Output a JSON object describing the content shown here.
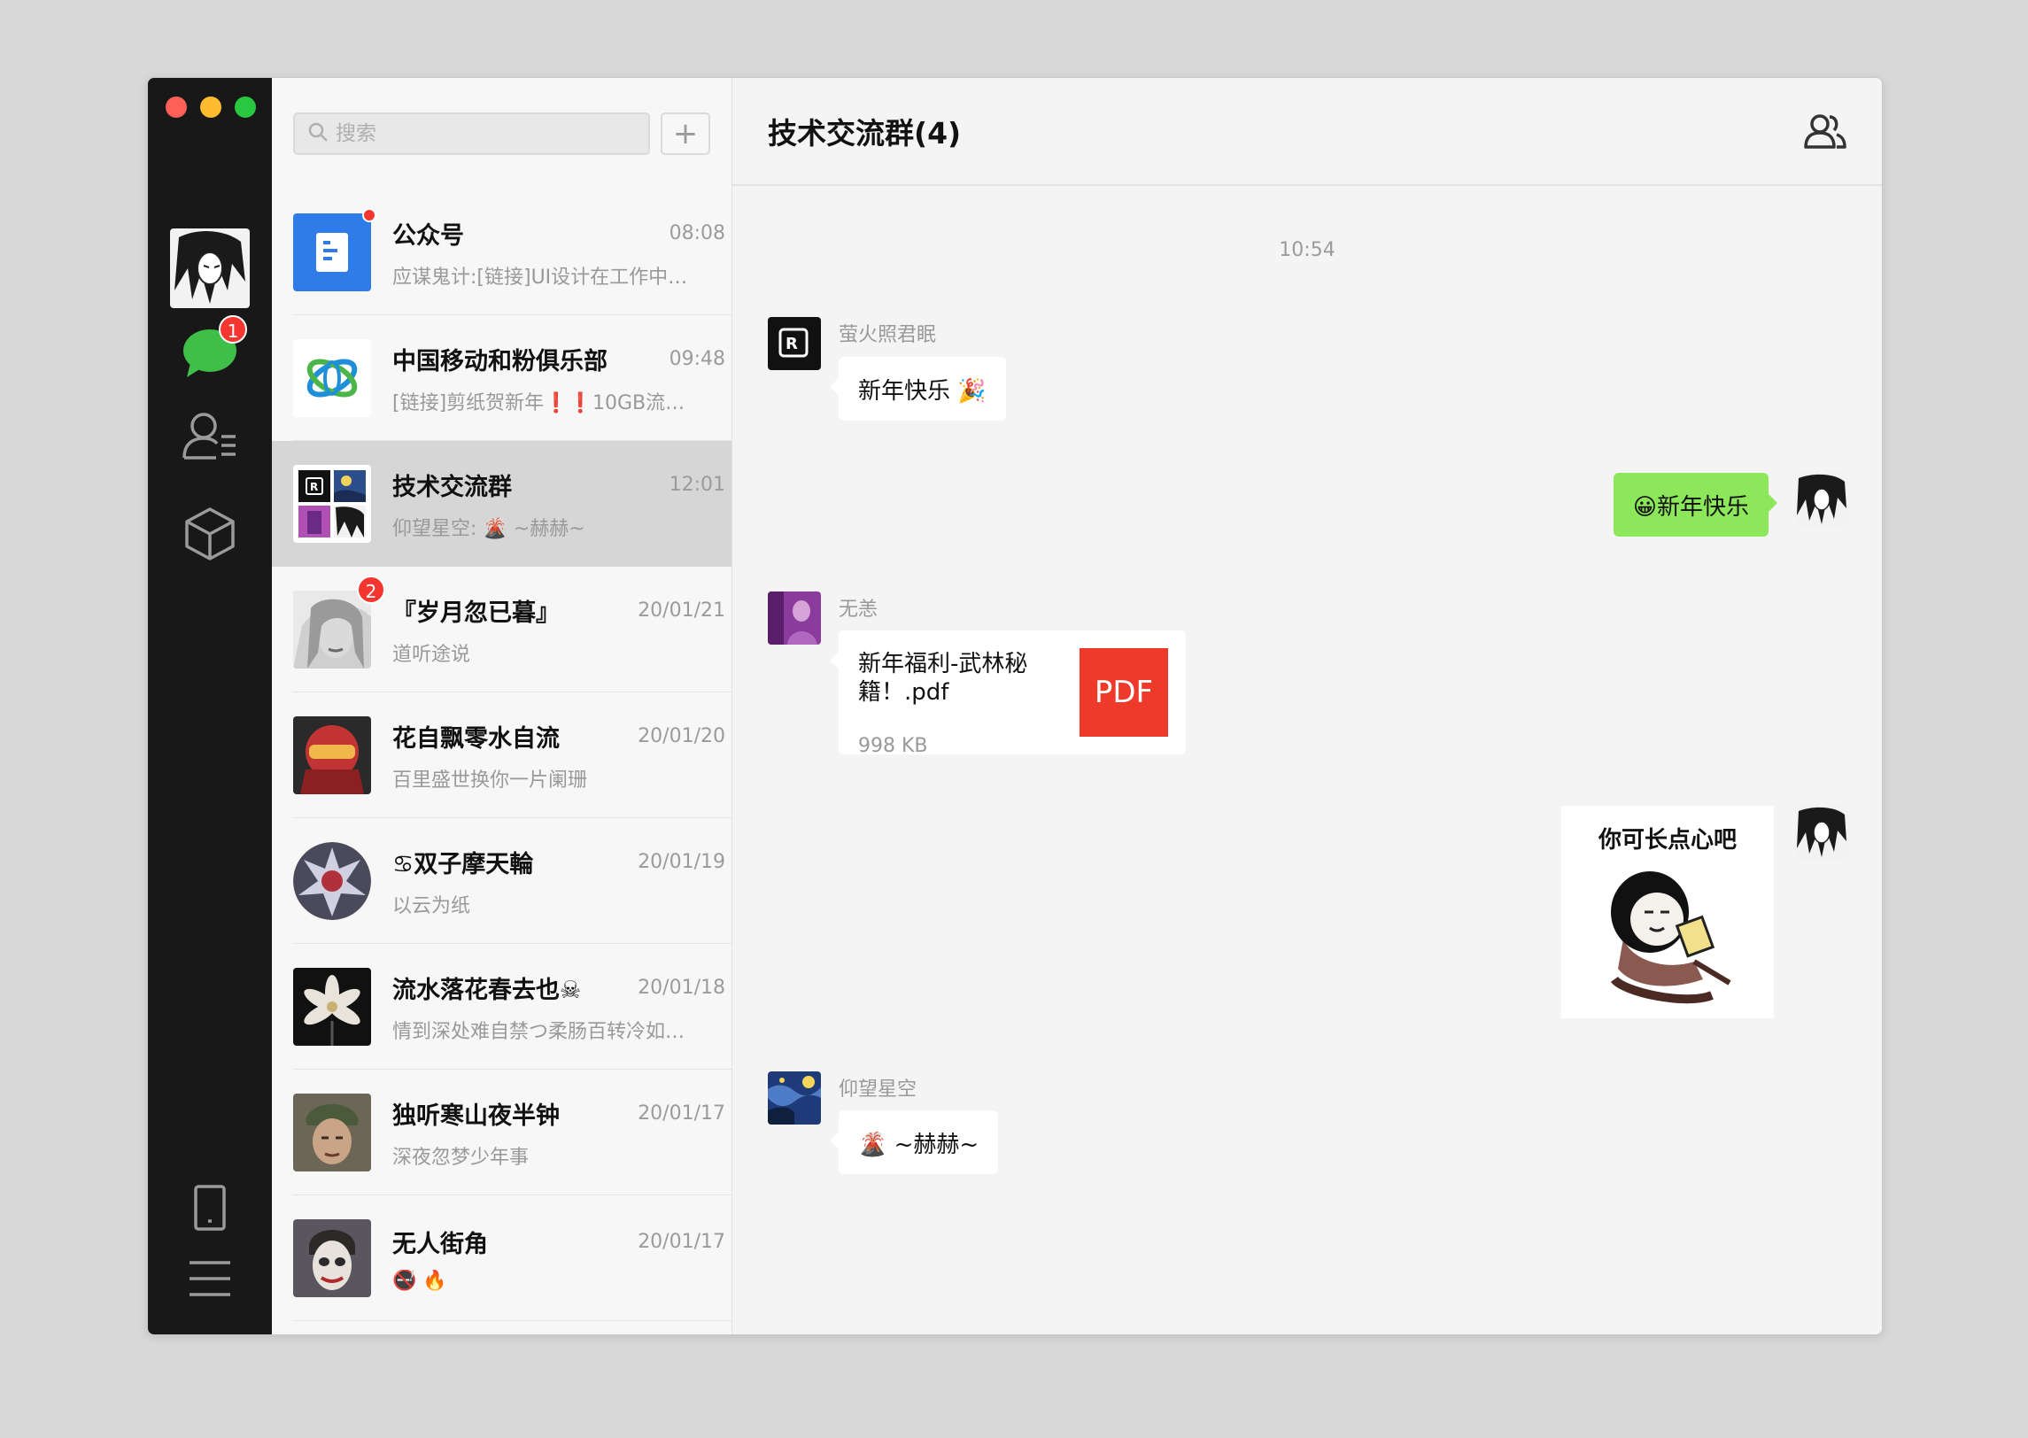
{
  "colors": {
    "accent_green": "#3fbf47",
    "badge_red": "#f43530",
    "own_bubble": "#8ce85a",
    "pdf_red": "#ee3a2b"
  },
  "rail": {
    "chat_badge": "1",
    "icons": [
      "chat-icon",
      "contacts-icon",
      "box-icon",
      "phone-icon",
      "menu-icon"
    ]
  },
  "search": {
    "placeholder": "搜索",
    "add_label": "+"
  },
  "chats": [
    {
      "name": "公众号",
      "time": "08:08",
      "preview": "应谋鬼计:[链接]UI设计在工作中…"
    },
    {
      "name": "中国移动和粉俱乐部",
      "time": "09:48",
      "preview": "[链接]剪纸贺新年❗❗10GB流…"
    },
    {
      "name": "技术交流群",
      "time": "12:01",
      "preview": "仰望星空: 🌋 ~赫赫~"
    },
    {
      "name": "『岁月忽已暮』",
      "time": "20/01/21",
      "preview": "道听途说",
      "badge": "2"
    },
    {
      "name": "花自飘零水自流",
      "time": "20/01/20",
      "preview": "百里盛世换你一片阑珊"
    },
    {
      "name": "♋双子摩天輪",
      "time": "20/01/19",
      "preview": "以云为纸"
    },
    {
      "name": "流水落花春去也☠",
      "time": "20/01/18",
      "preview": "情到深处难自禁つ柔肠百转冷如…"
    },
    {
      "name": "独听寒山夜半钟",
      "time": "20/01/17",
      "preview": "深夜忽梦少年事"
    },
    {
      "name": "无人街角",
      "time": "20/01/17",
      "preview": "🚭 🔥"
    }
  ],
  "conversation": {
    "title": "技术交流群(4)",
    "timestamp": "10:54",
    "messages": [
      {
        "sender": "萤火照君眠",
        "text": "新年快乐 🎉"
      },
      {
        "sender": "me",
        "text": "😀新年快乐"
      },
      {
        "sender": "无恙",
        "file_name": "新年福利-武林秘籍！.pdf",
        "file_size": "998 KB",
        "file_type": "PDF"
      },
      {
        "sender": "me",
        "sticker_caption": "你可长点心吧"
      },
      {
        "sender": "仰望星空",
        "text": "🌋 ~赫赫~"
      }
    ]
  }
}
